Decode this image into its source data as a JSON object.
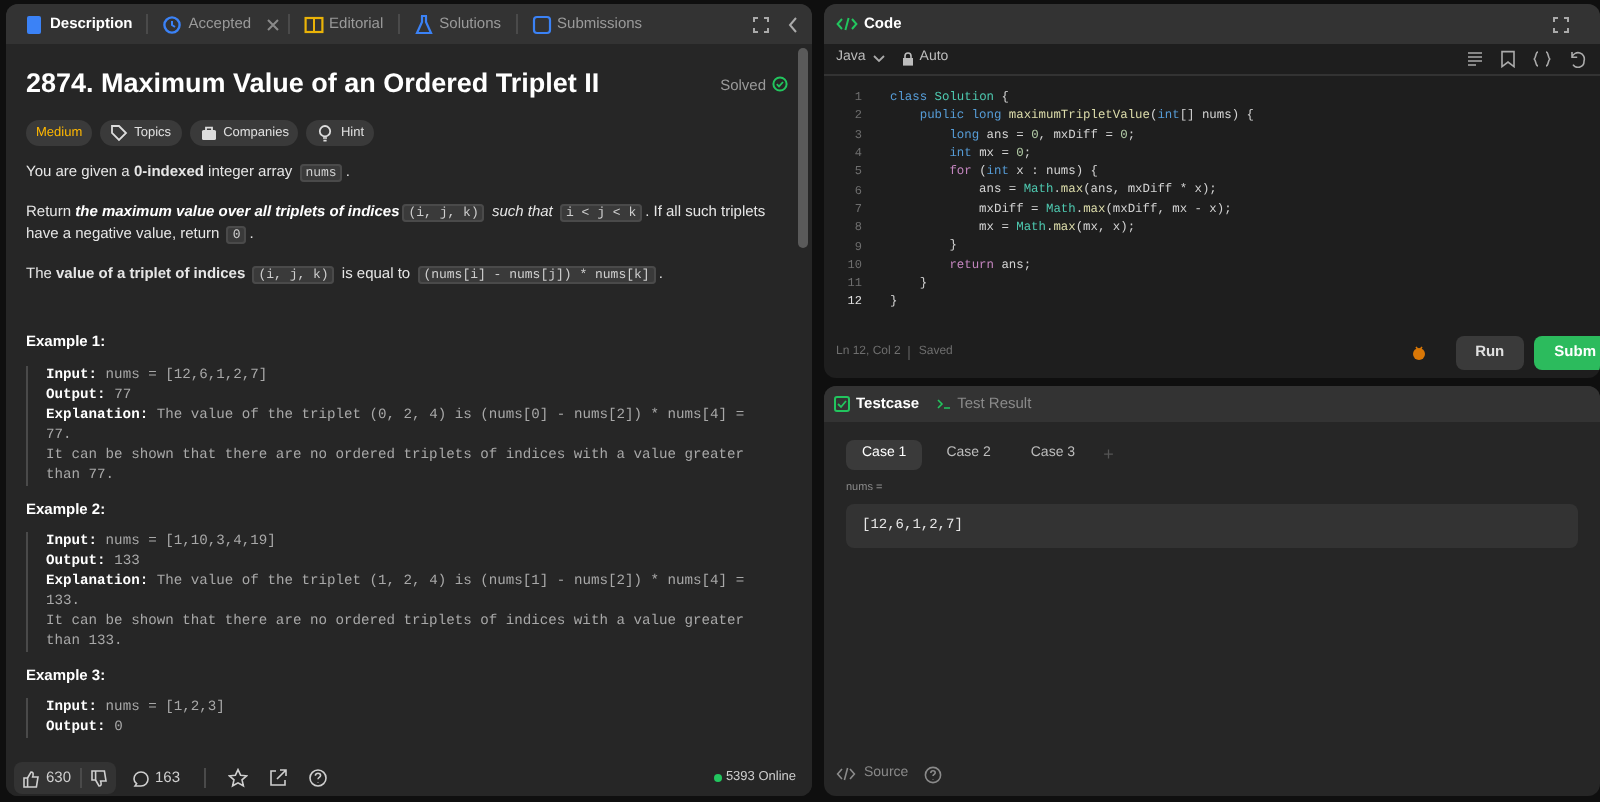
{
  "description_panel": {
    "tabs": [
      {
        "label": "Description",
        "selected": true,
        "closable": false
      },
      {
        "label": "Accepted",
        "selected": false,
        "closable": true
      },
      {
        "label": "Editorial",
        "selected": false,
        "closable": false
      },
      {
        "label": "Solutions",
        "selected": false,
        "closable": false
      },
      {
        "label": "Submissions",
        "selected": false,
        "closable": false
      }
    ],
    "title": "2874. Maximum Value of an Ordered Triplet II",
    "status": "Solved",
    "tags": [
      {
        "kind": "difficulty",
        "label": "Medium"
      },
      {
        "kind": "topics",
        "label": "Topics"
      },
      {
        "kind": "companies",
        "label": "Companies"
      },
      {
        "kind": "hint",
        "label": "Hint"
      }
    ],
    "paragraphs": [
      [
        {
          "kind": "text",
          "text": "You are given a **0-indexed** integer array "
        },
        {
          "kind": "code",
          "text": "nums"
        },
        {
          "kind": "text",
          "text": "."
        }
      ],
      [
        {
          "kind": "text",
          "text": "Return "
        },
        {
          "kind": "emph",
          "text": "the maximum value over all triplets of indices"
        },
        {
          "kind": "code",
          "text": "(i, j, k)"
        },
        {
          "kind": "text",
          "text": " *such that* "
        },
        {
          "kind": "code",
          "text": "i < j < k"
        },
        {
          "kind": "text",
          "text": ". If all such triplets have a negative value, return "
        },
        {
          "kind": "code",
          "text": "0"
        },
        {
          "kind": "text",
          "text": "."
        }
      ],
      [
        {
          "kind": "text",
          "text": "The **value of a triplet of indices** "
        },
        {
          "kind": "code",
          "text": "(i, j, k)"
        },
        {
          "kind": "text",
          "text": " is equal to "
        },
        {
          "kind": "code",
          "text": "(nums[i] - nums[j]) * nums[k]"
        },
        {
          "kind": "text",
          "text": "."
        }
      ]
    ],
    "examples": [
      {
        "title": "Example 1:",
        "lines": [
          "**Input:** nums = [12,6,1,2,7]",
          "**Output:** 77",
          "**Explanation:** The value of the triplet (0, 2, 4) is (nums[0] - nums[2]) * nums[4] = 77.",
          "It can be shown that there are no ordered triplets of indices with a value greater than 77."
        ]
      },
      {
        "title": "Example 2:",
        "lines": [
          "**Input:** nums = [1,10,3,4,19]",
          "**Output:** 133",
          "**Explanation:** The value of the triplet (1, 2, 4) is (nums[1] - nums[2]) * nums[4] = 133.",
          "It can be shown that there are no ordered triplets of indices with a value greater than 133."
        ]
      },
      {
        "title": "Example 3:",
        "lines": [
          "**Input:** nums = [1,2,3]",
          "**Output:** 0"
        ]
      }
    ],
    "footer": {
      "likes": "630",
      "comments": "163",
      "online": "5393 Online"
    }
  },
  "code_panel": {
    "title": "Code",
    "language": "Java",
    "mode": "Auto",
    "lines": [
      {
        "number": "1",
        "current": false,
        "tokens": [
          {
            "kind": "keyword",
            "text": "class"
          },
          {
            "kind": "type",
            "text": " Solution"
          },
          {
            "kind": "plain",
            "text": " {"
          }
        ]
      },
      {
        "number": "2",
        "current": false,
        "tokens": [
          {
            "kind": "keyword",
            "text": "    public long"
          },
          {
            "kind": "function",
            "text": " maximumTripletValue"
          },
          {
            "kind": "plain",
            "text": "("
          },
          {
            "kind": "keyword",
            "text": "int"
          },
          {
            "kind": "plain",
            "text": "[] nums) {"
          }
        ]
      },
      {
        "number": "3",
        "current": false,
        "tokens": [
          {
            "kind": "keyword",
            "text": "        long"
          },
          {
            "kind": "plain",
            "text": " ans = "
          },
          {
            "kind": "number",
            "text": "0"
          },
          {
            "kind": "plain",
            "text": ", mxDiff = "
          },
          {
            "kind": "number",
            "text": "0"
          },
          {
            "kind": "plain",
            "text": ";"
          }
        ]
      },
      {
        "number": "4",
        "current": false,
        "tokens": [
          {
            "kind": "keyword",
            "text": "        int"
          },
          {
            "kind": "plain",
            "text": " mx = "
          },
          {
            "kind": "number",
            "text": "0"
          },
          {
            "kind": "plain",
            "text": ";"
          }
        ]
      },
      {
        "number": "5",
        "current": false,
        "tokens": [
          {
            "kind": "control",
            "text": "        for"
          },
          {
            "kind": "plain",
            "text": " ("
          },
          {
            "kind": "keyword",
            "text": "int"
          },
          {
            "kind": "plain",
            "text": " x : nums) {"
          }
        ]
      },
      {
        "number": "6",
        "current": false,
        "tokens": [
          {
            "kind": "plain",
            "text": "            ans = "
          },
          {
            "kind": "type",
            "text": "Math"
          },
          {
            "kind": "plain",
            "text": "."
          },
          {
            "kind": "function",
            "text": "max"
          },
          {
            "kind": "plain",
            "text": "(ans, mxDiff * x);"
          }
        ]
      },
      {
        "number": "7",
        "current": false,
        "tokens": [
          {
            "kind": "plain",
            "text": "            mxDiff = "
          },
          {
            "kind": "type",
            "text": "Math"
          },
          {
            "kind": "plain",
            "text": "."
          },
          {
            "kind": "function",
            "text": "max"
          },
          {
            "kind": "plain",
            "text": "(mxDiff, mx - x);"
          }
        ]
      },
      {
        "number": "8",
        "current": false,
        "tokens": [
          {
            "kind": "plain",
            "text": "            mx = "
          },
          {
            "kind": "type",
            "text": "Math"
          },
          {
            "kind": "plain",
            "text": "."
          },
          {
            "kind": "function",
            "text": "max"
          },
          {
            "kind": "plain",
            "text": "(mx, x);"
          }
        ]
      },
      {
        "number": "9",
        "current": false,
        "tokens": [
          {
            "kind": "plain",
            "text": "        }"
          }
        ]
      },
      {
        "number": "10",
        "current": false,
        "tokens": [
          {
            "kind": "control",
            "text": "        return"
          },
          {
            "kind": "plain",
            "text": " ans;"
          }
        ]
      },
      {
        "number": "11",
        "current": false,
        "tokens": [
          {
            "kind": "plain",
            "text": "    }"
          }
        ]
      },
      {
        "number": "12",
        "current": true,
        "tokens": [
          {
            "kind": "plain",
            "text": "}"
          }
        ]
      }
    ],
    "cursor": "Ln 12, Col 2",
    "save_state": "Saved",
    "run_button": "Run",
    "submit_button": "Subm"
  },
  "testcase_panel": {
    "tabs": [
      {
        "label": "Testcase",
        "selected": true
      },
      {
        "label": "Test Result",
        "selected": false
      }
    ],
    "cases": [
      {
        "label": "Case 1",
        "selected": true
      },
      {
        "label": "Case 2",
        "selected": false
      },
      {
        "label": "Case 3",
        "selected": false
      }
    ],
    "add_case": "+",
    "param_label": "nums =",
    "param_value": "[12,6,1,2,7]",
    "source": "Source"
  }
}
